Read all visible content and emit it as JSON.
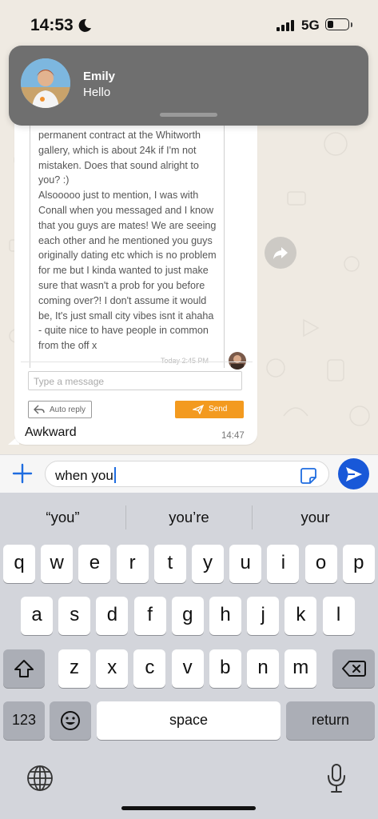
{
  "status_bar": {
    "time": "14:53",
    "network": "5G",
    "battery_level": 0.3,
    "icons": [
      "moon-icon",
      "cellular-signal-icon",
      "battery-icon"
    ]
  },
  "notification": {
    "sender": "Emily",
    "message": "Hello",
    "icon": "contact-avatar"
  },
  "message": {
    "quoted_text": "permanent contract at the Whitworth gallery, which is about 24k if I'm not mistaken. Does that sound alright to you? :)\nAlsooooo just to mention, I was with Conall when you messaged and I know that you guys are mates! We are seeing each other and he mentioned you guys originally dating etc which is no problem for me but I kinda wanted to just make sure that wasn't a prob for you before coming over?! I don't assume it would be, It's just small city vibes isnt it ahaha - quite nice to have people in common from the off x",
    "quoted_timestamp": "Today 2:45 PM",
    "reply_placeholder": "Type a message",
    "auto_reply_label": "Auto reply",
    "send_label": "Send",
    "text": "Awkward",
    "time": "14:47"
  },
  "composer": {
    "input_value": "when you",
    "icons": [
      "plus-icon",
      "sticker-icon",
      "send-icon"
    ]
  },
  "keyboard": {
    "suggestions": [
      "“you”",
      "you’re",
      "your"
    ],
    "row1": [
      "q",
      "w",
      "e",
      "r",
      "t",
      "y",
      "u",
      "i",
      "o",
      "p"
    ],
    "row2": [
      "a",
      "s",
      "d",
      "f",
      "g",
      "h",
      "j",
      "k",
      "l"
    ],
    "row3": [
      "z",
      "x",
      "c",
      "v",
      "b",
      "n",
      "m"
    ],
    "numbers_label": "123",
    "space_label": "space",
    "return_label": "return",
    "icons": [
      "shift-icon",
      "backspace-icon",
      "emoji-icon",
      "globe-icon",
      "microphone-icon"
    ]
  },
  "colors": {
    "accent_blue": "#1858d8",
    "orange": "#f39a1f",
    "chat_bg": "#efeae2"
  }
}
